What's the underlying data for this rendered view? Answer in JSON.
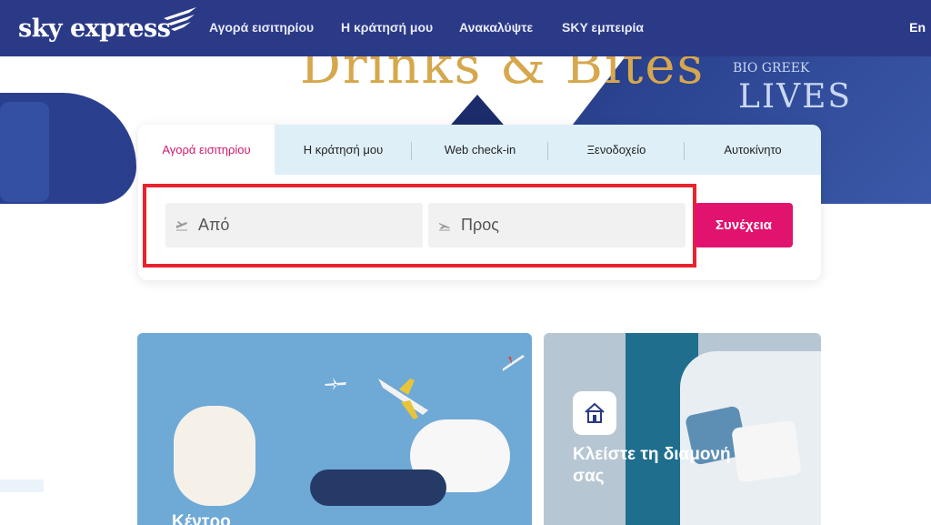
{
  "nav": {
    "logo": "sky express",
    "items": [
      "Αγορά εισιτηρίου",
      "Η κράτησή μου",
      "Ανακαλύψτε",
      "SKY εμπειρία"
    ],
    "lang": "En"
  },
  "hero": {
    "title": "Drinks & Bites",
    "jar_line1": "BIO GREEK",
    "jar_line2": "LIVES"
  },
  "booking": {
    "tabs": [
      "Αγορά εισιτηρίου",
      "Η κράτησή μου",
      "Web check-in",
      "Ξενοδοχείο",
      "Αυτοκίνητο"
    ],
    "active_tab": 0,
    "from_placeholder": "Από",
    "to_placeholder": "Προς",
    "continue_label": "Συνέχεια"
  },
  "cards": {
    "left_title": "Κέντρο",
    "right_title": "Κλείστε τη διαμονή σας"
  },
  "colors": {
    "nav_bg": "#2b3a86",
    "accent": "#e2126f",
    "tab_bg": "#deeff8",
    "highlight": "#e8232f"
  }
}
